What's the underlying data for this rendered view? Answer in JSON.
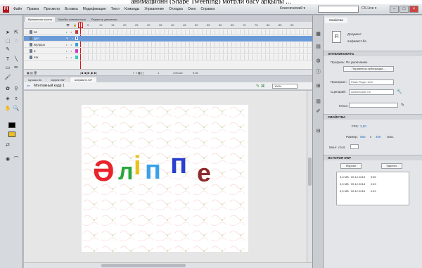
{
  "caption": "анимационн (Shape Tweening) мотрли басу арқылы ...",
  "app": {
    "logo": "Fl",
    "menu": [
      "Файл",
      "Правка",
      "Просмотр",
      "Вставка",
      "Модификация",
      "Текст",
      "Команды",
      "Управление",
      "Отладка",
      "Окно",
      "Справка"
    ],
    "workspace": "Классический ▾",
    "cs_live": "CS Live ▾"
  },
  "timeline": {
    "tabs": [
      "Временная шкала",
      "Ошибки компилятора",
      "Редактор движения"
    ],
    "ruler": [
      "5",
      "10",
      "15",
      "20",
      "25",
      "30",
      "35",
      "40",
      "45",
      "50",
      "55",
      "60",
      "65",
      "70",
      "75",
      "80",
      "85",
      "90"
    ],
    "layers": [
      {
        "name": "пе",
        "color": "#c93a3a",
        "selected": false
      },
      {
        "name": "дәл",
        "color": "#3a6fd8",
        "selected": true
      },
      {
        "name": "жұлдыз",
        "color": "#3aa0d8",
        "selected": false
      },
      {
        "name": "ә",
        "color": "#c83ac8",
        "selected": false
      },
      {
        "name": "етк",
        "color": "#3ac8c8",
        "selected": false
      }
    ],
    "footer_fps": "1",
    "footer_rate": "3,00 к/с",
    "footer_time": "0,0s"
  },
  "doc_tabs": [
    "музыка.fla",
    "эффект.fla*",
    "алфавит1.fla*"
  ],
  "edit_bar": {
    "scene": "Монтажный кадр 1",
    "zoom": "100%"
  },
  "stage_word": {
    "letters": [
      {
        "char": "Ә",
        "color": "#e8232a"
      },
      {
        "char": "л",
        "color": "#27a83a"
      },
      {
        "char": "і",
        "color": "#e8c21a"
      },
      {
        "char": "п",
        "color": "#3aa0e8"
      },
      {
        "char": "п",
        "color": "#2a3fd0"
      },
      {
        "char": "е",
        "color": "#8e2a2a"
      }
    ]
  },
  "icon_strip": [
    "color-icon",
    "swatches-icon",
    "align-icon",
    "info-icon",
    "transform-icon",
    "library-icon",
    "brush-icon",
    "component-icon"
  ],
  "properties": {
    "tab": "Свойства",
    "doc_type": "Документ",
    "file_name": "алфавит1.fla",
    "publish_section": "ОПУБЛИКОВАТЬ",
    "profile_label": "Профиль: По умолчанию",
    "publish_settings_btn": "Параметры публикации...",
    "player_label": "Проигрыв.:",
    "player_value": "Flash Player 10.2",
    "script_label": "Сценарий:",
    "script_value": "ActionScript 3.0",
    "class_label": "Класс:",
    "props_section": "СВОЙСТВА",
    "fps_label": "FPS:",
    "fps_value": "3,00",
    "size_label": "Размер:",
    "size_w": "550",
    "size_x": "x",
    "size_h": "400",
    "size_unit": "пикс.",
    "stage_label": "Монт. стол:",
    "history_section": "ИСТОРИЯ SWF",
    "journal_btn": "Журнал",
    "delete_btn": "Удалить",
    "history": [
      {
        "size": "3,5 MB",
        "date": "05.12.2018",
        "time": "9:55"
      },
      {
        "size": "3,5 MB",
        "date": "05.12.2018",
        "time": "9:49"
      },
      {
        "size": "3,5 MB",
        "date": "05.12.2018",
        "time": "9:49"
      }
    ]
  },
  "tools_panel": [
    "selection-tool-icon",
    "subselection-tool-icon",
    "free-transform-icon",
    "lasso-icon",
    "pen-tool-icon",
    "text-tool-icon",
    "line-tool-icon",
    "rectangle-tool-icon",
    "pencil-tool-icon",
    "brush-tool-icon",
    "deco-tool-icon",
    "bone-tool-icon",
    "paint-bucket-icon",
    "eyedropper-icon",
    "eraser-icon",
    "hand-tool-icon",
    "zoom-tool-icon"
  ],
  "colors": {
    "stroke": "#000000",
    "fill": "#f0c020"
  }
}
